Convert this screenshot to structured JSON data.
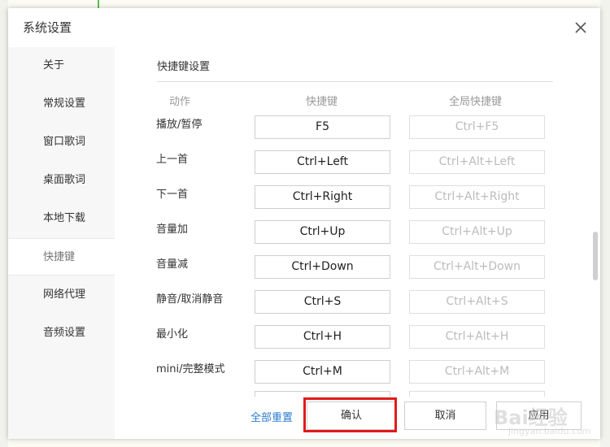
{
  "dialog": {
    "title": "系统设置"
  },
  "sidebar": {
    "items": [
      {
        "label": "关于"
      },
      {
        "label": "常规设置"
      },
      {
        "label": "窗口歌词"
      },
      {
        "label": "桌面歌词"
      },
      {
        "label": "本地下载"
      },
      {
        "label": "快捷键"
      },
      {
        "label": "网络代理"
      },
      {
        "label": "音频设置"
      }
    ],
    "active_index": 5
  },
  "hotkeys": {
    "section_title": "快捷键设置",
    "headers": {
      "action": "动作",
      "hotkey": "快捷键",
      "global": "全局快捷键"
    },
    "rows": [
      {
        "action": "播放/暂停",
        "hotkey": "F5",
        "global": "Ctrl+F5"
      },
      {
        "action": "上一首",
        "hotkey": "Ctrl+Left",
        "global": "Ctrl+Alt+Left"
      },
      {
        "action": "下一首",
        "hotkey": "Ctrl+Right",
        "global": "Ctrl+Alt+Right"
      },
      {
        "action": "音量加",
        "hotkey": "Ctrl+Up",
        "global": "Ctrl+Alt+Up"
      },
      {
        "action": "音量减",
        "hotkey": "Ctrl+Down",
        "global": "Ctrl+Alt+Down"
      },
      {
        "action": "静音/取消静音",
        "hotkey": "Ctrl+S",
        "global": "Ctrl+Alt+S"
      },
      {
        "action": "最小化",
        "hotkey": "Ctrl+H",
        "global": "Ctrl+Alt+H"
      },
      {
        "action": "mini/完整模式",
        "hotkey": "Ctrl+M",
        "global": "Ctrl+Alt+M"
      }
    ]
  },
  "footer": {
    "reset_label": "全部重置",
    "confirm_label": "确认",
    "cancel_label": "取消",
    "apply_label": "应用"
  },
  "watermark": {
    "text": "Bai经验",
    "sub": "jingyan.baidu.com"
  },
  "colors": {
    "highlight": "#e01b1b",
    "link": "#2c7bd1",
    "accent_green": "#5cbf4a"
  }
}
